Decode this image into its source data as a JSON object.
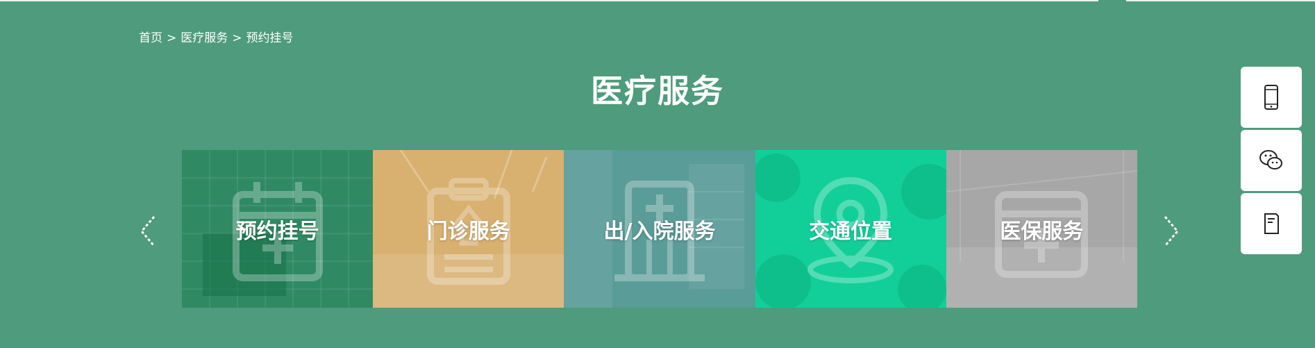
{
  "breadcrumb": {
    "items": [
      "首页",
      "医疗服务",
      "预约挂号"
    ],
    "separator": ">"
  },
  "page_title": "医疗服务",
  "carousel": {
    "cards": [
      {
        "label": "预约挂号",
        "icon": "calendar-plus-icon",
        "color": "#2f8a63"
      },
      {
        "label": "门诊服务",
        "icon": "clipboard-icon",
        "color": "#d8b070"
      },
      {
        "label": "出/入院服务",
        "icon": "hospital-building-icon",
        "color": "#5a9c98"
      },
      {
        "label": "交通位置",
        "icon": "location-pin-icon",
        "color": "#12cf9a"
      },
      {
        "label": "医保服务",
        "icon": "medical-insurance-card-icon",
        "color": "#a7a7a7"
      }
    ],
    "prev_icon": "chevron-left-icon",
    "next_icon": "chevron-right-icon"
  },
  "side_tools": [
    {
      "icon": "mobile-phone-icon"
    },
    {
      "icon": "wechat-icon"
    },
    {
      "icon": "document-icon"
    }
  ],
  "colors": {
    "background": "#4e9b7d",
    "text": "#ffffff",
    "tool_bg": "#ffffff"
  }
}
